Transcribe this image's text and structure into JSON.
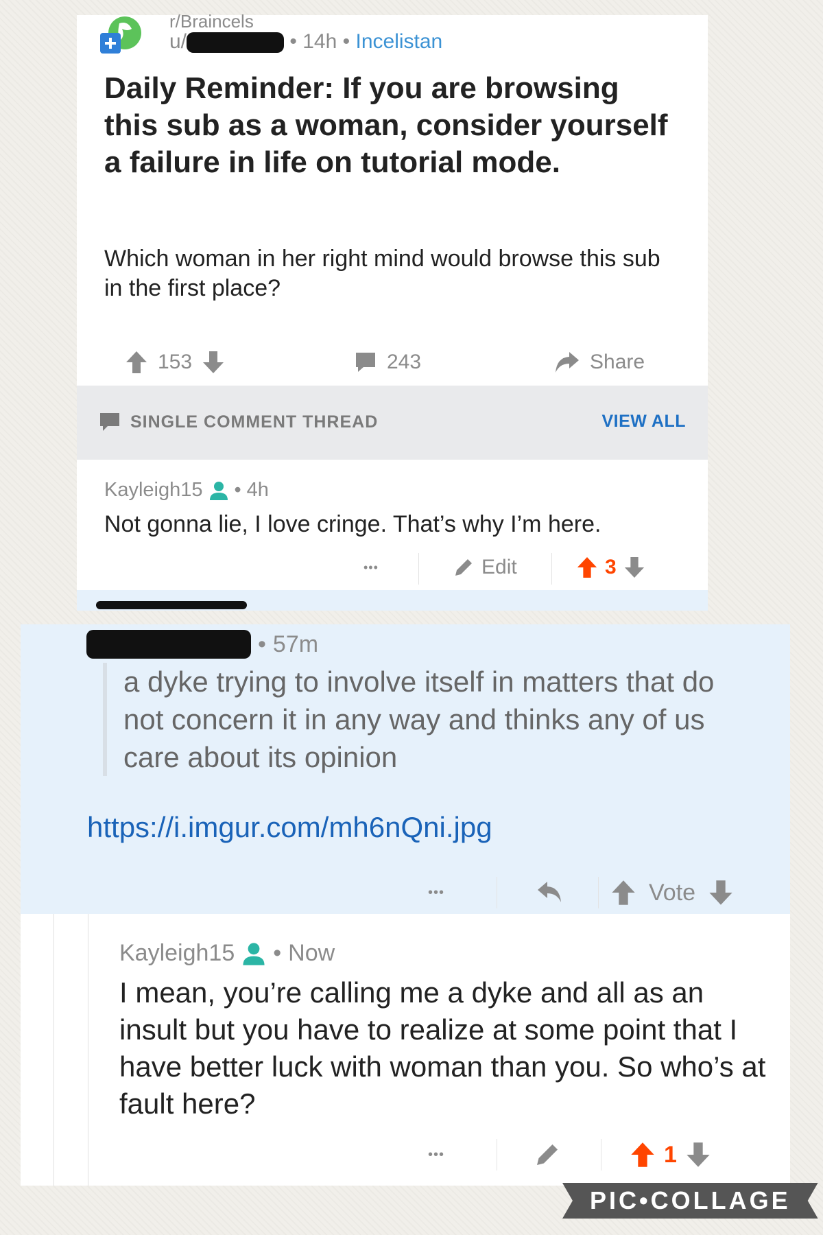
{
  "post": {
    "subreddit": "r/Braincels",
    "author_prefix": "u/",
    "age": "14h",
    "flair": "Incelistan",
    "title": "Daily Reminder: If you are browsing this sub as a woman, consider yourself a failure in life on tutorial mode.",
    "body": "Which woman in her right mind would browse this sub in the first place?",
    "upvotes": "153",
    "comments": "243",
    "share_label": "Share"
  },
  "thread_header": {
    "label": "SINGLE COMMENT THREAD",
    "view_all": "VIEW ALL"
  },
  "comment1": {
    "author": "Kayleigh15",
    "age": "4h",
    "text": "Not gonna lie, I love cringe. That’s why I’m here.",
    "more": "•••",
    "edit_label": "Edit",
    "score": "3"
  },
  "reply": {
    "age": "57m",
    "quote": "a dyke trying to involve itself in matters that do not concern it in any way and thinks any of us care about its opinion",
    "link": "https://i.imgur.com/mh6nQni.jpg",
    "more": "•••",
    "vote_label": "Vote"
  },
  "comment3": {
    "author": "Kayleigh15",
    "age": "Now",
    "text": "I mean, you’re calling me a dyke and all as an insult but you have to realize at some point that I have better luck with woman than you. So who’s at fault here?",
    "more": "•••",
    "score": "1"
  },
  "watermark": "PIC•COLLAGE",
  "colors": {
    "accent_blue": "#1e70c4",
    "upvote_orange": "#ff4500",
    "moderator_teal": "#2bb5a5",
    "reply_bg": "#e6f1fb"
  }
}
